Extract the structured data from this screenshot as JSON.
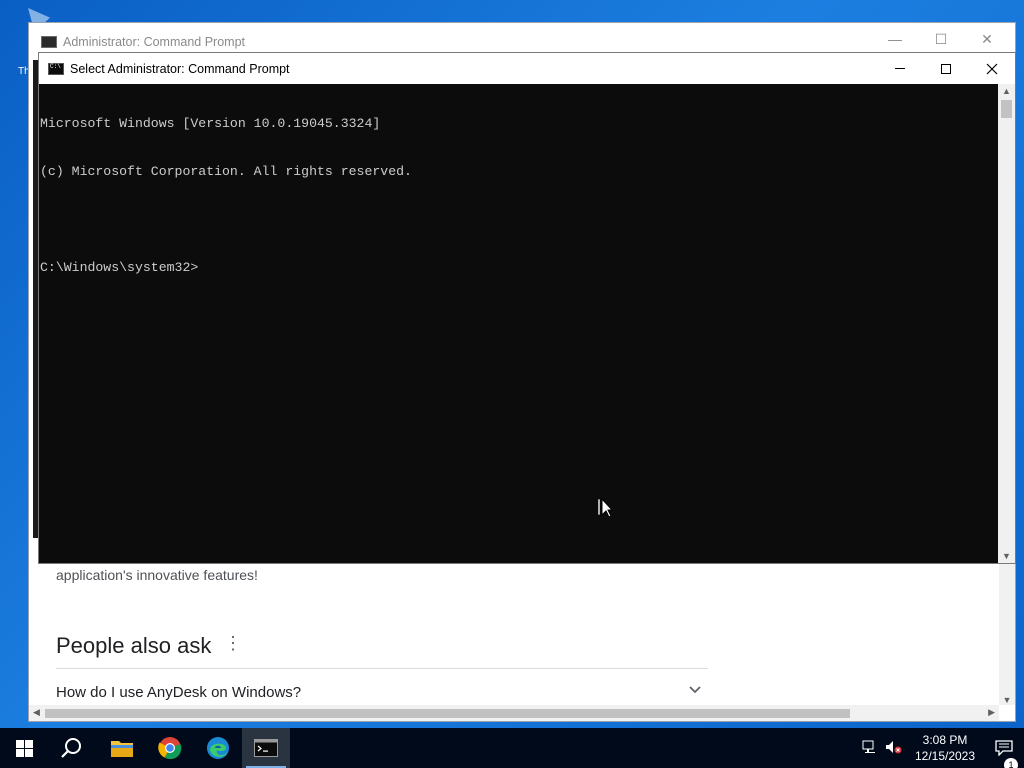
{
  "desktop": {
    "icon_label": "Th"
  },
  "browser": {
    "title": "Administrator: Command Prompt",
    "snippet_text": "application's innovative features!",
    "people_also_ask_title": "People also ask",
    "question_1": "How do I use AnyDesk on Windows?",
    "menu_glyph": "⋮",
    "chevron_glyph": "⌄"
  },
  "cmd": {
    "title": "Select Administrator: Command Prompt",
    "lines": [
      "Microsoft Windows [Version 10.0.19045.3324]",
      "(c) Microsoft Corporation. All rights reserved.",
      "",
      "C:\\Windows\\system32>"
    ],
    "close_glyph": "✕"
  },
  "taskbar": {
    "apps": [
      {
        "name": "start-button",
        "icon": "windows-logo"
      },
      {
        "name": "search-button",
        "icon": "search-icon"
      },
      {
        "name": "file-explorer-button",
        "icon": "folder-icon"
      },
      {
        "name": "chrome-button",
        "icon": "chrome-icon"
      },
      {
        "name": "edge-button",
        "icon": "edge-icon"
      },
      {
        "name": "command-prompt-button",
        "icon": "cmd-icon",
        "active": true
      }
    ],
    "time": "3:08 PM",
    "date": "12/15/2023",
    "notification_count": "1"
  },
  "colors": {
    "desktop": "#0a5fc4",
    "console_bg": "#0c0c0c",
    "console_fg": "#cccccc",
    "taskbar": "#000a1a"
  }
}
